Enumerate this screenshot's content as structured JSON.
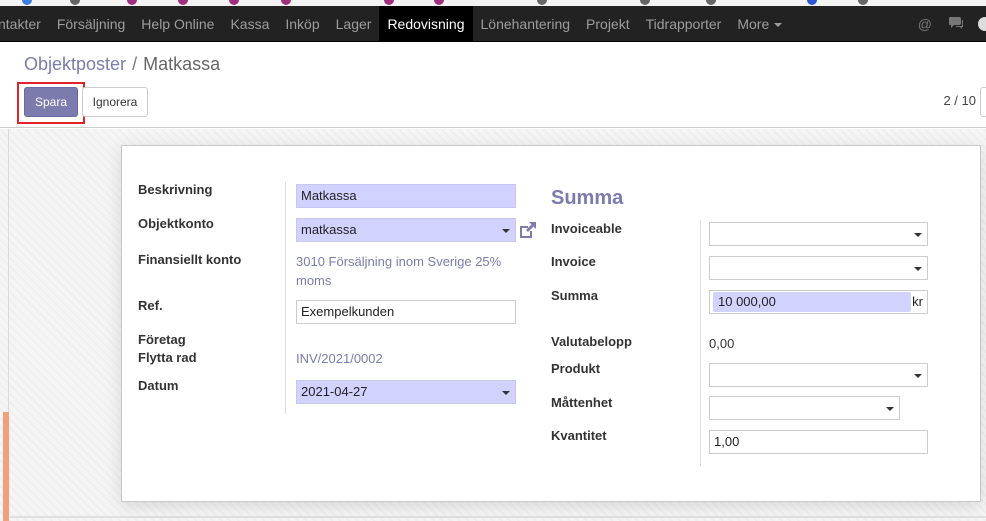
{
  "navbar": {
    "items": [
      {
        "label": "ntakter"
      },
      {
        "label": "Försäljning"
      },
      {
        "label": "Help Online"
      },
      {
        "label": "Kassa"
      },
      {
        "label": "Inköp"
      },
      {
        "label": "Lager"
      },
      {
        "label": "Redovisning",
        "active": true
      },
      {
        "label": "Lönehantering"
      },
      {
        "label": "Projekt"
      },
      {
        "label": "Tidrapporter"
      }
    ],
    "more_label": "More",
    "icons": [
      "at-icon",
      "chat-icon",
      "avatar"
    ]
  },
  "breadcrumb": {
    "parent": "Objektposter",
    "separator": "/",
    "current": "Matkassa"
  },
  "buttons": {
    "save": "Spara",
    "discard": "Ignorera"
  },
  "pager": {
    "text": "2 / 10"
  },
  "form": {
    "left": {
      "description_label": "Beskrivning",
      "description_value": "Matkassa",
      "account_label": "Objektkonto",
      "account_value": "matkassa",
      "financial_label": "Finansiellt konto",
      "financial_value": "3010 Försäljning inom Sverige 25% moms",
      "ref_label": "Ref.",
      "ref_value": "Exempelkunden",
      "company_label": "Företag",
      "move_label": "Flytta rad",
      "move_value": "INV/2021/0002",
      "date_label": "Datum",
      "date_value": "2021-04-27"
    },
    "right": {
      "section_title": "Summa",
      "invoiceable_label": "Invoiceable",
      "invoiceable_value": "",
      "invoice_label": "Invoice",
      "invoice_value": "",
      "amount_label": "Summa",
      "amount_value": "10 000,00",
      "amount_currency": "kr",
      "currency_amount_label": "Valutabelopp",
      "currency_amount_value": "0,00",
      "product_label": "Produkt",
      "product_value": "",
      "uom_label": "Måttenhet",
      "uom_value": "",
      "quantity_label": "Kvantitet",
      "quantity_value": "1,00"
    }
  },
  "colors": {
    "navbar_bg": "#222222",
    "primary": "#7c7bad",
    "required_field": "#d2d2ff",
    "highlight": "#e3232a"
  }
}
